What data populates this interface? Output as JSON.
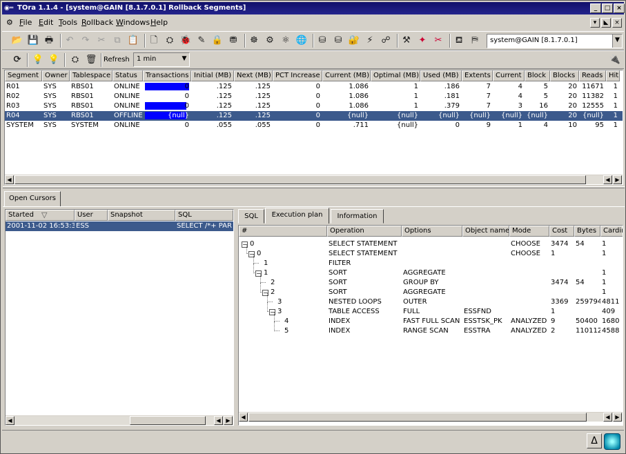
{
  "window": {
    "title": "TOra 1.1.4 - [system@GAIN [8.1.7.0.1] Rollback Segments]",
    "title_icon": "tora-icon",
    "min": "_",
    "max": "□",
    "close": "×"
  },
  "menu": [
    "File",
    "Edit",
    "Tools",
    "Rollback",
    "Windows",
    "Help"
  ],
  "menu_underline": [
    "F",
    "E",
    "T",
    "R",
    "W",
    "H"
  ],
  "connection": "system@GAIN [8.1.7.0.1]",
  "refresh": {
    "label": "Refresh",
    "value": "1 min"
  },
  "segments": {
    "columns": [
      "Segment",
      "Owner",
      "Tablespace",
      "Status",
      "Transactions",
      "Initial (MB)",
      "Next (MB)",
      "PCT Increase",
      "Current (MB)",
      "Optimal (MB)",
      "Used (MB)",
      "Extents",
      "Current",
      "Block",
      "Blocks",
      "Reads",
      "Hitr"
    ],
    "rows": [
      [
        "R01",
        "SYS",
        "RBS01",
        "ONLINE",
        "0",
        ".125",
        ".125",
        "0",
        "1.086",
        "1",
        ".186",
        "7",
        "4",
        "5",
        "20",
        "11671",
        "1"
      ],
      [
        "R02",
        "SYS",
        "RBS01",
        "ONLINE",
        "0",
        ".125",
        ".125",
        "0",
        "1.086",
        "1",
        ".181",
        "7",
        "4",
        "5",
        "20",
        "11382",
        "1"
      ],
      [
        "R03",
        "SYS",
        "RBS01",
        "ONLINE",
        "0",
        ".125",
        ".125",
        "0",
        "1.086",
        "1",
        ".379",
        "7",
        "3",
        "16",
        "20",
        "12555",
        "1"
      ],
      [
        "R04",
        "SYS",
        "RBS01",
        "OFFLINE",
        "{null}",
        ".125",
        ".125",
        "0",
        "{null}",
        "{null}",
        "{null}",
        "{null}",
        "{null}",
        "{null}",
        "20",
        "{null}",
        "1"
      ],
      [
        "SYSTEM",
        "SYS",
        "SYSTEM",
        "ONLINE",
        "0",
        ".055",
        ".055",
        "0",
        ".711",
        "{null}",
        "0",
        "9",
        "1",
        "4",
        "10",
        "95",
        "1"
      ]
    ],
    "transaction_fill": [
      1.0,
      0,
      0.93,
      0.93,
      0
    ],
    "selected_row": 3
  },
  "cursors": {
    "tab": "Open Cursors",
    "columns": [
      "Started",
      "User",
      "Snapshot",
      "SQL"
    ],
    "rows": [
      [
        "2001-11-02 16:53:33",
        "ESS",
        "",
        "SELECT /*+ PAR"
      ]
    ]
  },
  "plan": {
    "tabs": [
      "SQL",
      "Execution plan",
      "Information"
    ],
    "columns": [
      "#",
      "Operation",
      "Options",
      "Object name",
      "Mode",
      "Cost",
      "Bytes",
      "Cardin"
    ],
    "rows": [
      {
        "id": "0",
        "op": "SELECT STATEMENT",
        "opt": "",
        "obj": "",
        "mode": "CHOOSE",
        "cost": "3474",
        "bytes": "54",
        "card": "1"
      },
      {
        "id": "0",
        "op": "SELECT STATEMENT",
        "opt": "",
        "obj": "",
        "mode": "CHOOSE",
        "cost": "1",
        "bytes": "",
        "card": "1"
      },
      {
        "id": "1",
        "op": "FILTER",
        "opt": "",
        "obj": "",
        "mode": "",
        "cost": "",
        "bytes": "",
        "card": ""
      },
      {
        "id": "1",
        "op": "SORT",
        "opt": "AGGREGATE",
        "obj": "",
        "mode": "",
        "cost": "",
        "bytes": "",
        "card": "1"
      },
      {
        "id": "2",
        "op": "SORT",
        "opt": "GROUP BY",
        "obj": "",
        "mode": "",
        "cost": "3474",
        "bytes": "54",
        "card": "1"
      },
      {
        "id": "2",
        "op": "SORT",
        "opt": "AGGREGATE",
        "obj": "",
        "mode": "",
        "cost": "",
        "bytes": "",
        "card": "1"
      },
      {
        "id": "3",
        "op": "NESTED LOOPS",
        "opt": "OUTER",
        "obj": "",
        "mode": "",
        "cost": "3369",
        "bytes": "259794",
        "card": "4811"
      },
      {
        "id": "3",
        "op": "TABLE ACCESS",
        "opt": "FULL",
        "obj": "ESSFND",
        "mode": "",
        "cost": "1",
        "bytes": "",
        "card": "409"
      },
      {
        "id": "4",
        "op": "INDEX",
        "opt": "FAST FULL SCAN",
        "obj": "ESSTSK_PK",
        "mode": "ANALYZED",
        "cost": "9",
        "bytes": "50400",
        "card": "1680"
      },
      {
        "id": "5",
        "op": "INDEX",
        "opt": "RANGE SCAN",
        "obj": "ESSTRA",
        "mode": "ANALYZED",
        "cost": "2",
        "bytes": "110112",
        "card": "4588"
      }
    ]
  },
  "status": {
    "delta": "Δ"
  }
}
